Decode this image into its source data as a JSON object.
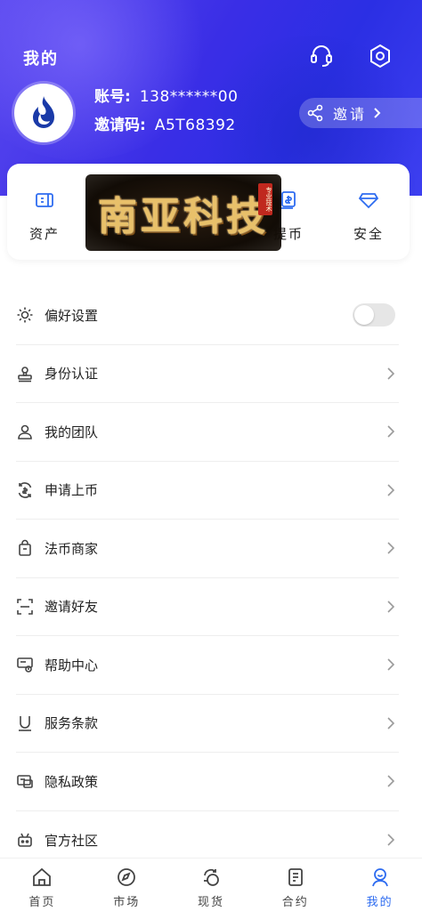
{
  "header": {
    "title": "我的",
    "account_label": "账号:",
    "account_value": "138******00",
    "invite_code_label": "邀请码:",
    "invite_code_value": "A5T68392",
    "invite_button": "邀请",
    "accent": "#3a2ee6"
  },
  "quick_actions": [
    {
      "label": "资产",
      "icon": "asset-icon"
    },
    {
      "label": "提币",
      "icon": "withdraw-icon"
    },
    {
      "label": "安全",
      "icon": "diamond-icon"
    }
  ],
  "overlay_logo": {
    "text": "南亚科技",
    "seal": "专业技术"
  },
  "menu": {
    "items": [
      {
        "label": "偏好设置",
        "icon": "sun-icon",
        "toggle_on": false
      },
      {
        "label": "身份认证",
        "icon": "stamp-icon"
      },
      {
        "label": "我的团队",
        "icon": "user-icon"
      },
      {
        "label": "申请上币",
        "icon": "coin-cycle-icon"
      },
      {
        "label": "法币商家",
        "icon": "shop-bag-icon"
      },
      {
        "label": "邀请好友",
        "icon": "scan-frame-icon"
      },
      {
        "label": "帮助中心",
        "icon": "help-card-icon"
      },
      {
        "label": "服务条款",
        "icon": "terms-icon"
      },
      {
        "label": "隐私政策",
        "icon": "privacy-icon"
      },
      {
        "label": "官方社区",
        "icon": "robot-icon"
      }
    ]
  },
  "tabbar": {
    "items": [
      {
        "label": "首页",
        "icon": "home-icon"
      },
      {
        "label": "市场",
        "icon": "compass-icon"
      },
      {
        "label": "现货",
        "icon": "spot-icon"
      },
      {
        "label": "合约",
        "icon": "contract-icon"
      },
      {
        "label": "我的",
        "icon": "profile-icon",
        "active": true
      }
    ],
    "active_color": "#2e6cf0"
  }
}
